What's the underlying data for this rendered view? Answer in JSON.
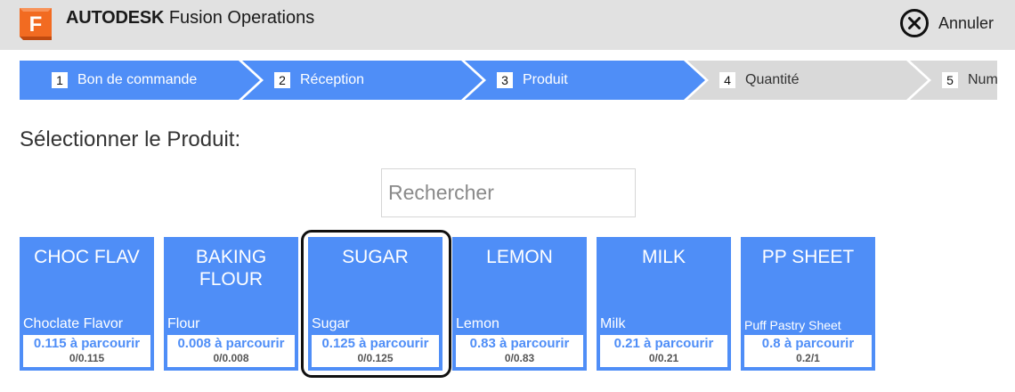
{
  "header": {
    "brand_main": "AUTODESK",
    "brand_product": "Fusion Operations",
    "logo_letter": "F",
    "cancel_label": "Annuler",
    "colors": {
      "logo_orange": "#f26b21",
      "background": "#e1e1e1"
    }
  },
  "stepper": {
    "colors": {
      "active": "#4f8ef7",
      "inactive": "#d9d9d9"
    },
    "steps": [
      {
        "number": "1",
        "label": "Bon de commande",
        "state": "active"
      },
      {
        "number": "2",
        "label": "Réception",
        "state": "active"
      },
      {
        "number": "3",
        "label": "Produit",
        "state": "active"
      },
      {
        "number": "4",
        "label": "Quantité",
        "state": "inactive"
      },
      {
        "number": "5",
        "label": "Num",
        "state": "inactive"
      }
    ]
  },
  "main": {
    "title": "Sélectionner le Produit:",
    "search_placeholder": "Rechercher"
  },
  "products": [
    {
      "code": "CHOC FLAV",
      "name": "Choclate Flavor",
      "remaining": "0.115 à parcourir",
      "ratio": "0/0.115"
    },
    {
      "code": "BAKING FLOUR",
      "name": "Flour",
      "remaining": "0.008 à parcourir",
      "ratio": "0/0.008"
    },
    {
      "code": "SUGAR",
      "name": "Sugar",
      "remaining": "0.125 à parcourir",
      "ratio": "0/0.125",
      "selected": true
    },
    {
      "code": "LEMON",
      "name": "Lemon",
      "remaining": "0.83 à parcourir",
      "ratio": "0/0.83"
    },
    {
      "code": "MILK",
      "name": "Milk",
      "remaining": "0.21 à parcourir",
      "ratio": "0/0.21"
    },
    {
      "code": "PP SHEET",
      "name": "Puff Pastry Sheet",
      "remaining": "0.8 à parcourir",
      "ratio": "0.2/1"
    }
  ],
  "icons": {
    "logo": "autodesk-fusion-logo-icon",
    "cancel": "close-circle-icon"
  },
  "card_color": "#4f8ef7"
}
